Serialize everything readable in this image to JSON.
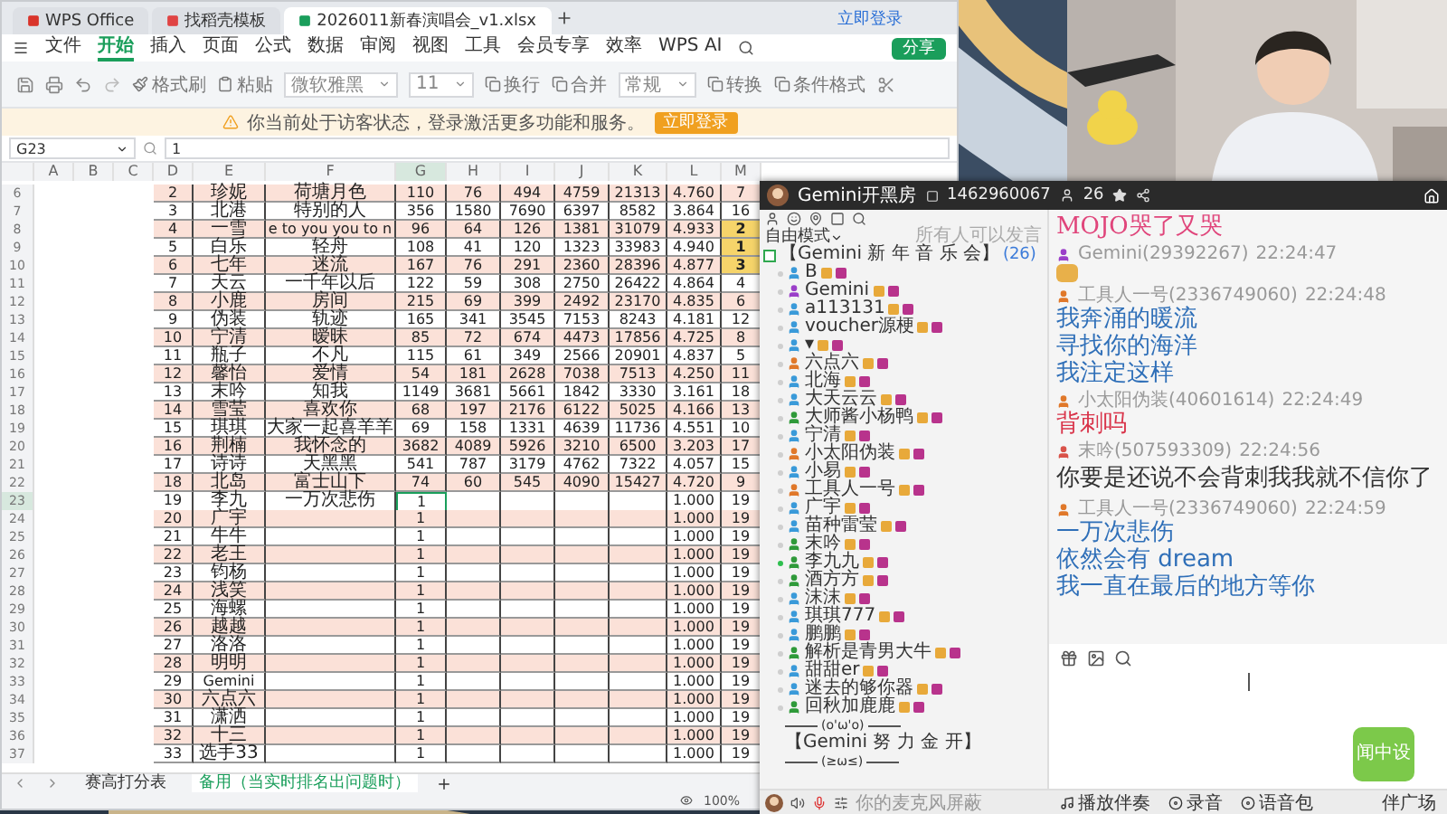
{
  "wps": {
    "tabs": [
      {
        "label": "WPS Office",
        "kind": "home",
        "selected": false
      },
      {
        "label": "找稻壳模板",
        "kind": "template",
        "selected": false
      },
      {
        "label": "2026011新春演唱会_v1.xlsx",
        "kind": "sheet",
        "selected": true
      }
    ],
    "login_link": "立即登录",
    "share": "分享",
    "menu": [
      {
        "label": "文件",
        "selected": false
      },
      {
        "label": "开始",
        "selected": true
      },
      {
        "label": "插入",
        "selected": false
      },
      {
        "label": "页面",
        "selected": false
      },
      {
        "label": "公式",
        "selected": false
      },
      {
        "label": "数据",
        "selected": false
      },
      {
        "label": "审阅",
        "selected": false
      },
      {
        "label": "视图",
        "selected": false
      },
      {
        "label": "工具",
        "selected": false
      },
      {
        "label": "会员专享",
        "selected": false
      },
      {
        "label": "效率",
        "selected": false
      },
      {
        "label": "WPS AI",
        "selected": false
      }
    ],
    "toolbar": [
      {
        "label": "格式刷",
        "kind": "button"
      },
      {
        "label": "粘贴",
        "kind": "button"
      },
      {
        "label": "微软雅黑",
        "kind": "dropdown"
      },
      {
        "label": "11",
        "kind": "dropdown"
      },
      {
        "label": "换行",
        "kind": "button"
      },
      {
        "label": "合并",
        "kind": "button"
      },
      {
        "label": "常规",
        "kind": "dropdown"
      },
      {
        "label": "转换",
        "kind": "button"
      },
      {
        "label": "条件格式",
        "kind": "button"
      }
    ],
    "notice": {
      "text": "你当前处于访客状态，登录激活更多功能和服务。",
      "button": "立即登录"
    },
    "formula_bar": {
      "cell": "G23",
      "value": "1"
    },
    "sheet": {
      "columns": [
        {
          "label": "A",
          "selected": false
        },
        {
          "label": "B",
          "selected": false
        },
        {
          "label": "C",
          "selected": false
        },
        {
          "label": "D",
          "selected": false
        },
        {
          "label": "E",
          "selected": false
        },
        {
          "label": "F",
          "selected": false
        },
        {
          "label": "G",
          "selected": true
        },
        {
          "label": "H",
          "selected": false
        },
        {
          "label": "I",
          "selected": false
        },
        {
          "label": "J",
          "selected": false
        },
        {
          "label": "K",
          "selected": false
        },
        {
          "label": "L",
          "selected": false
        },
        {
          "label": "M",
          "selected": false
        }
      ],
      "rows": [
        {
          "number": "6",
          "selected": false,
          "rank_highlight": false,
          "cells": {
            "D": "2",
            "E": "珍妮",
            "F": "荷塘月色",
            "G": "110",
            "H": "76",
            "I": "494",
            "J": "4759",
            "K": "21313",
            "L": "4.760",
            "M": "7"
          }
        },
        {
          "number": "7",
          "selected": false,
          "rank_highlight": false,
          "cells": {
            "D": "3",
            "E": "北港",
            "F": "特别的人",
            "G": "356",
            "H": "1580",
            "I": "7690",
            "J": "6397",
            "K": "8582",
            "L": "3.864",
            "M": "16"
          }
        },
        {
          "number": "8",
          "selected": false,
          "rank_highlight": true,
          "cells": {
            "D": "4",
            "E": "一雪",
            "F": "e to you you to n",
            "G": "96",
            "H": "64",
            "I": "126",
            "J": "1381",
            "K": "31079",
            "L": "4.933",
            "M": "2"
          }
        },
        {
          "number": "9",
          "selected": false,
          "rank_highlight": true,
          "cells": {
            "D": "5",
            "E": "白乐",
            "F": "轻舟",
            "G": "108",
            "H": "41",
            "I": "120",
            "J": "1323",
            "K": "33983",
            "L": "4.940",
            "M": "1"
          }
        },
        {
          "number": "10",
          "selected": false,
          "rank_highlight": true,
          "cells": {
            "D": "6",
            "E": "七年",
            "F": "迷流",
            "G": "167",
            "H": "76",
            "I": "291",
            "J": "2360",
            "K": "28396",
            "L": "4.877",
            "M": "3"
          }
        },
        {
          "number": "11",
          "selected": false,
          "rank_highlight": false,
          "cells": {
            "D": "7",
            "E": "天云",
            "F": "一千年以后",
            "G": "122",
            "H": "59",
            "I": "308",
            "J": "2750",
            "K": "26422",
            "L": "4.864",
            "M": "4"
          }
        },
        {
          "number": "12",
          "selected": false,
          "rank_highlight": false,
          "cells": {
            "D": "8",
            "E": "小鹿",
            "F": "房间",
            "G": "215",
            "H": "69",
            "I": "399",
            "J": "2492",
            "K": "23170",
            "L": "4.835",
            "M": "6"
          }
        },
        {
          "number": "13",
          "selected": false,
          "rank_highlight": false,
          "cells": {
            "D": "9",
            "E": "伪装",
            "F": "轨迹",
            "G": "165",
            "H": "341",
            "I": "3545",
            "J": "7153",
            "K": "8243",
            "L": "4.181",
            "M": "12"
          }
        },
        {
          "number": "14",
          "selected": false,
          "rank_highlight": false,
          "cells": {
            "D": "10",
            "E": "宁清",
            "F": "暧昧",
            "G": "85",
            "H": "72",
            "I": "674",
            "J": "4473",
            "K": "17856",
            "L": "4.725",
            "M": "8"
          }
        },
        {
          "number": "15",
          "selected": false,
          "rank_highlight": false,
          "cells": {
            "D": "11",
            "E": "瓶子",
            "F": "不凡",
            "G": "115",
            "H": "61",
            "I": "349",
            "J": "2566",
            "K": "20901",
            "L": "4.837",
            "M": "5"
          }
        },
        {
          "number": "16",
          "selected": false,
          "rank_highlight": false,
          "cells": {
            "D": "12",
            "E": "馨怡",
            "F": "爱情",
            "G": "54",
            "H": "181",
            "I": "2628",
            "J": "7038",
            "K": "7513",
            "L": "4.250",
            "M": "11"
          }
        },
        {
          "number": "17",
          "selected": false,
          "rank_highlight": false,
          "cells": {
            "D": "13",
            "E": "末吟",
            "F": "知我",
            "G": "1149",
            "H": "3681",
            "I": "5661",
            "J": "1842",
            "K": "3330",
            "L": "3.161",
            "M": "18"
          }
        },
        {
          "number": "18",
          "selected": false,
          "rank_highlight": false,
          "cells": {
            "D": "14",
            "E": "雪莹",
            "F": "喜欢你",
            "G": "68",
            "H": "197",
            "I": "2176",
            "J": "6122",
            "K": "5025",
            "L": "4.166",
            "M": "13"
          }
        },
        {
          "number": "19",
          "selected": false,
          "rank_highlight": false,
          "cells": {
            "D": "15",
            "E": "琪琪",
            "F": "大家一起喜羊羊",
            "G": "69",
            "H": "158",
            "I": "1331",
            "J": "4639",
            "K": "11736",
            "L": "4.551",
            "M": "10"
          }
        },
        {
          "number": "20",
          "selected": false,
          "rank_highlight": false,
          "cells": {
            "D": "16",
            "E": "荆楠",
            "F": "我怀念的",
            "G": "3682",
            "H": "4089",
            "I": "5926",
            "J": "3210",
            "K": "6500",
            "L": "3.203",
            "M": "17"
          }
        },
        {
          "number": "21",
          "selected": false,
          "rank_highlight": false,
          "cells": {
            "D": "17",
            "E": "诗诗",
            "F": "天黑黑",
            "G": "541",
            "H": "787",
            "I": "3179",
            "J": "4762",
            "K": "7322",
            "L": "4.057",
            "M": "15"
          }
        },
        {
          "number": "22",
          "selected": false,
          "rank_highlight": false,
          "cells": {
            "D": "18",
            "E": "北岛",
            "F": "富士山下",
            "G": "74",
            "H": "60",
            "I": "545",
            "J": "4090",
            "K": "15427",
            "L": "4.720",
            "M": "9"
          }
        },
        {
          "number": "23",
          "selected": true,
          "rank_highlight": false,
          "cells": {
            "D": "19",
            "E": "李九",
            "F": "一万次悲伤",
            "G": "1",
            "L": "1.000",
            "M": "19"
          }
        },
        {
          "number": "24",
          "selected": false,
          "rank_highlight": false,
          "cells": {
            "D": "20",
            "E": "广宇",
            "G": "1",
            "L": "1.000",
            "M": "19"
          }
        },
        {
          "number": "25",
          "selected": false,
          "rank_highlight": false,
          "cells": {
            "D": "21",
            "E": "牛牛",
            "G": "1",
            "L": "1.000",
            "M": "19"
          }
        },
        {
          "number": "26",
          "selected": false,
          "rank_highlight": false,
          "cells": {
            "D": "22",
            "E": "老王",
            "G": "1",
            "L": "1.000",
            "M": "19"
          }
        },
        {
          "number": "27",
          "selected": false,
          "rank_highlight": false,
          "cells": {
            "D": "23",
            "E": "钧杨",
            "G": "1",
            "L": "1.000",
            "M": "19"
          }
        },
        {
          "number": "28",
          "selected": false,
          "rank_highlight": false,
          "cells": {
            "D": "24",
            "E": "浅笑",
            "G": "1",
            "L": "1.000",
            "M": "19"
          }
        },
        {
          "number": "29",
          "selected": false,
          "rank_highlight": false,
          "cells": {
            "D": "25",
            "E": "海螺",
            "G": "1",
            "L": "1.000",
            "M": "19"
          }
        },
        {
          "number": "30",
          "selected": false,
          "rank_highlight": false,
          "cells": {
            "D": "26",
            "E": "越越",
            "G": "1",
            "L": "1.000",
            "M": "19"
          }
        },
        {
          "number": "31",
          "selected": false,
          "rank_highlight": false,
          "cells": {
            "D": "27",
            "E": "洛洛",
            "G": "1",
            "L": "1.000",
            "M": "19"
          }
        },
        {
          "number": "32",
          "selected": false,
          "rank_highlight": false,
          "cells": {
            "D": "28",
            "E": "明明",
            "G": "1",
            "L": "1.000",
            "M": "19"
          }
        },
        {
          "number": "33",
          "selected": false,
          "rank_highlight": false,
          "cells": {
            "D": "29",
            "E": "Gemini",
            "G": "1",
            "L": "1.000",
            "M": "19"
          }
        },
        {
          "number": "34",
          "selected": false,
          "rank_highlight": false,
          "cells": {
            "D": "30",
            "E": "六点六",
            "G": "1",
            "L": "1.000",
            "M": "19"
          }
        },
        {
          "number": "35",
          "selected": false,
          "rank_highlight": false,
          "cells": {
            "D": "31",
            "E": "潇洒",
            "G": "1",
            "L": "1.000",
            "M": "19"
          }
        },
        {
          "number": "36",
          "selected": false,
          "rank_highlight": false,
          "cells": {
            "D": "32",
            "E": "十三",
            "G": "1",
            "L": "1.000",
            "M": "19"
          }
        },
        {
          "number": "37",
          "selected": false,
          "rank_highlight": false,
          "cells": {
            "D": "33",
            "E": "选手33",
            "G": "1",
            "L": "1.000",
            "M": "19"
          }
        }
      ]
    },
    "sheet_tabs": [
      {
        "label": "赛高打分表",
        "selected": false
      },
      {
        "label": "备用（当实时排名出问题时）",
        "selected": true
      }
    ],
    "zoom": "100%"
  },
  "chat": {
    "title": "Gemini开黑房",
    "room_id": "1462960067",
    "online": "26",
    "mode": "自由模式",
    "mode_note": "所有人可以发言",
    "channel": {
      "name": "【Gemini 新 年 音 乐 会】",
      "count": "(26)",
      "expanded": true,
      "members": [
        {
          "name": "B",
          "color": "#3a9ad9",
          "speaking": false
        },
        {
          "name": "Gemini",
          "color": "#9b3fc9",
          "speaking": false
        },
        {
          "name": "a113131",
          "color": "#3a9ad9",
          "speaking": false
        },
        {
          "name": "voucher源梗",
          "color": "#3a9ad9",
          "speaking": false
        },
        {
          "name": "▾",
          "color": "#3a9ad9",
          "speaking": false
        },
        {
          "name": "六点六",
          "color": "#e0782a",
          "speaking": false
        },
        {
          "name": "北海",
          "color": "#3a9ad9",
          "speaking": false
        },
        {
          "name": "大天云云",
          "color": "#3a9ad9",
          "speaking": false
        },
        {
          "name": "大师酱小杨鸭",
          "color": "#2f9a3a",
          "speaking": false
        },
        {
          "name": "宁清",
          "color": "#3a9ad9",
          "speaking": false
        },
        {
          "name": "小太阳伪装",
          "color": "#e0782a",
          "speaking": false
        },
        {
          "name": "小易",
          "color": "#3a9ad9",
          "speaking": false
        },
        {
          "name": "工具人一号",
          "color": "#e0782a",
          "speaking": false
        },
        {
          "name": "广宇",
          "color": "#3a9ad9",
          "speaking": false
        },
        {
          "name": "苗种雷莹",
          "color": "#3a9ad9",
          "speaking": false
        },
        {
          "name": "末吟",
          "color": "#2f9a3a",
          "speaking": false
        },
        {
          "name": "李九九",
          "color": "#2f9a3a",
          "speaking": true
        },
        {
          "name": "酒方方",
          "color": "#2f9a3a",
          "speaking": false
        },
        {
          "name": "沫沫",
          "color": "#3a9ad9",
          "speaking": false
        },
        {
          "name": "琪琪777",
          "color": "#3a9ad9",
          "speaking": false
        },
        {
          "name": "鹏鹏",
          "color": "#3a9ad9",
          "speaking": false
        },
        {
          "name": "解析是青男大牛",
          "color": "#2f9a3a",
          "speaking": false
        },
        {
          "name": "甜甜er",
          "color": "#3a9ad9",
          "speaking": false
        },
        {
          "name": "迷去的够你器",
          "color": "#3a9ad9",
          "speaking": false
        },
        {
          "name": "回秋加鹿鹿",
          "color": "#2f9a3a",
          "speaking": false
        }
      ]
    },
    "after_channel": [
      {
        "kind": "divider",
        "label": "(o'ω'o)"
      },
      {
        "kind": "channel",
        "label": "【Gemini 努 力 金 开】"
      },
      {
        "kind": "divider",
        "label": "(≥ω≤)"
      }
    ],
    "messages": [
      {
        "kind": "serif",
        "color": "#e0457b",
        "lines": [
          "MOJO哭了又哭"
        ]
      },
      {
        "kind": "emoji",
        "author": {
          "name": "Gemini(29392267)",
          "color": "#9b3fc9"
        },
        "time": "22:24:47"
      },
      {
        "kind": "sans",
        "color": "#2f6fb8",
        "author": {
          "name": "工具人一号(2336749060)",
          "color": "#e0782a"
        },
        "time": "22:24:48",
        "lines": [
          "我奔涌的暖流",
          "寻找你的海洋",
          "我注定这样"
        ]
      },
      {
        "kind": "serif",
        "color": "#d9344a",
        "author": {
          "name": "小太阳伪装(40601614)",
          "color": "#e0782a"
        },
        "time": "22:24:49",
        "lines": [
          "背刺吗"
        ]
      },
      {
        "kind": "serif",
        "color": "#333333",
        "author": {
          "name": "末吟(507593309)",
          "color": "#d9534a"
        },
        "time": "22:24:56",
        "lines": [
          "你要是还说不会背刺我我就不信你了"
        ]
      },
      {
        "kind": "sans",
        "color": "#2f6fb8",
        "author": {
          "name": "工具人一号(2336749060)",
          "color": "#e0782a"
        },
        "time": "22:24:59",
        "lines": [
          "一万次悲伤",
          "依然会有 dream",
          "我一直在最后的地方等你"
        ]
      }
    ],
    "mic_hint": "你的麦克风屏蔽",
    "bottom_actions": [
      "播放伴奏",
      "录音",
      "语音包"
    ],
    "plaza": "伴广场",
    "sticker": "闻中设"
  }
}
